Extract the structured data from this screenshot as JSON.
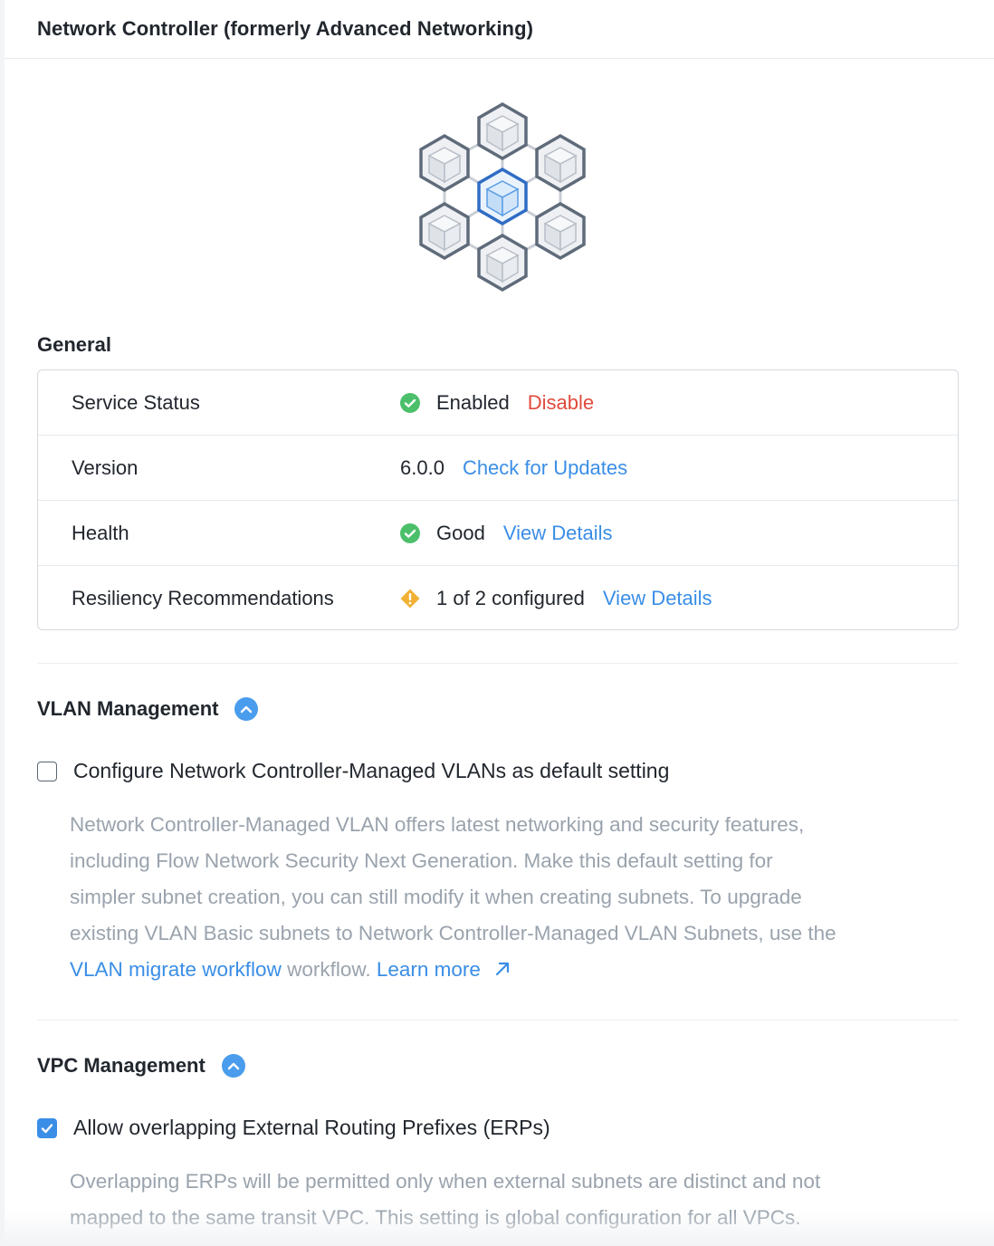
{
  "header": {
    "title": "Network Controller (formerly Advanced Networking)"
  },
  "general": {
    "title": "General",
    "rows": [
      {
        "label": "Service Status",
        "icon": "check-circle-icon",
        "value": "Enabled",
        "action": "Disable"
      },
      {
        "label": "Version",
        "value": "6.0.0",
        "action": "Check for Updates"
      },
      {
        "label": "Health",
        "icon": "check-circle-icon",
        "value": "Good",
        "action": "View Details"
      },
      {
        "label": "Resiliency Recommendations",
        "icon": "warning-diamond-icon",
        "value": "1 of 2 configured",
        "action": "View Details"
      }
    ]
  },
  "vlan": {
    "title": "VLAN Management",
    "checkbox_label": "Configure Network Controller-Managed VLANs as default setting",
    "checked": false,
    "desc_lines": [
      "Network Controller-Managed VLAN offers latest networking and security features,",
      "including Flow Network Security Next Generation. Make this default setting for",
      "simpler subnet creation, you can still modify it when creating subnets. To upgrade",
      "existing VLAN Basic subnets to Network Controller-Managed VLAN Subnets, use the"
    ],
    "migrate_link": "VLAN migrate workflow",
    "after_link_text": " workflow. ",
    "learn_more": "Learn more"
  },
  "vpc": {
    "title": "VPC Management",
    "checkbox_label": "Allow overlapping External Routing Prefixes (ERPs)",
    "checked": true,
    "desc_lines": [
      "Overlapping ERPs will be permitted only when external subnets are distinct and not",
      "mapped to the same transit VPC. This setting is global configuration for all VPCs."
    ]
  },
  "colors": {
    "accent": "#3a8ee6",
    "success": "#4cbf6b",
    "warning": "#f2b134",
    "danger": "#e04a3c"
  }
}
